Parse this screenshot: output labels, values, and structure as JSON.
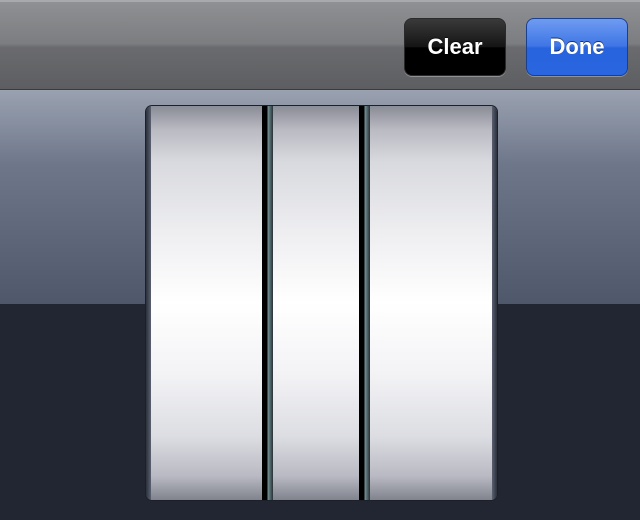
{
  "toolbar": {
    "clear_label": "Clear",
    "done_label": "Done"
  },
  "picker": {
    "wheel_count": 3
  },
  "colors": {
    "done_accent": "#2763dd",
    "clear_button": "#000000",
    "toolbar": "#7c7d80",
    "background": "#222633"
  }
}
